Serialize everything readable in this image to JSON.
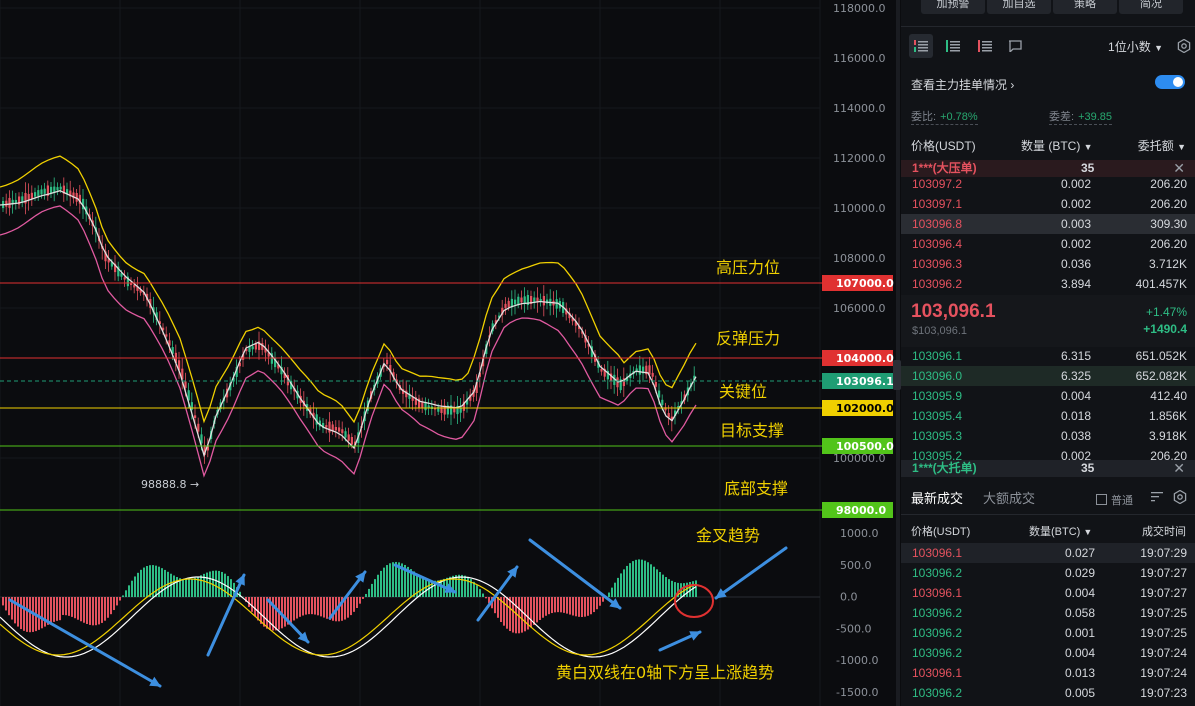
{
  "chart": {
    "y_axis_labels": [
      "118000.0",
      "116000.0",
      "114000.0",
      "112000.0",
      "110000.0",
      "108000.0",
      "106000.0",
      "104000.0",
      "102000.0",
      "100000.0"
    ],
    "macd_axis_labels": [
      "1000.0",
      "500.0",
      "0.0",
      "-500.0",
      "-1000.0",
      "-1500.0"
    ],
    "price_tags": [
      {
        "label": "107000.0",
        "bg": "#e03131",
        "fg": "#ffffff"
      },
      {
        "label": "104000.0",
        "bg": "#e03131",
        "fg": "#ffffff"
      },
      {
        "label": "103096.1",
        "bg": "#1f9d74",
        "fg": "#ffffff"
      },
      {
        "label": "102000.0",
        "bg": "#f0d000",
        "fg": "#000000"
      },
      {
        "label": "100500.0",
        "bg": "#52c41a",
        "fg": "#ffffff"
      },
      {
        "label": "98000.0",
        "bg": "#52c41a",
        "fg": "#ffffff"
      }
    ],
    "annotations": {
      "high_pressure": "高压力位",
      "rebound_pressure": "反弹压力",
      "key_level": "关键位",
      "target_support": "目标支撑",
      "bottom_support": "底部支撑",
      "golden_cross": "金叉趋势",
      "macd_note": "黄白双线在0轴下方呈上涨趋势",
      "low_marker": "98888.8 →"
    },
    "colors": {
      "up": "#2ebd85",
      "down": "#e5525f",
      "yellow": "#f0d000",
      "green_line": "#52c41a",
      "red_line": "#e03131"
    }
  },
  "panel": {
    "top_buttons": [
      "加预警",
      "加自选",
      "策略",
      "简况"
    ],
    "decimal_selector": "1位小数",
    "main_orders_label": "查看主力挂单情况",
    "ratio": {
      "label": "委比:",
      "value": "+0.78%"
    },
    "diff": {
      "label": "委差:",
      "value": "+39.85"
    },
    "book_headers": {
      "price": "价格(USDT)",
      "qty": "数量 (BTC)",
      "total": "委托额"
    },
    "ask_big": {
      "label": "1***(大压单)",
      "count": "35"
    },
    "asks": [
      {
        "price": "103097.2",
        "qty": "0.002",
        "total": "206.20"
      },
      {
        "price": "103097.1",
        "qty": "0.002",
        "total": "206.20"
      },
      {
        "price": "103096.8",
        "qty": "0.003",
        "total": "309.30"
      },
      {
        "price": "103096.4",
        "qty": "0.002",
        "total": "206.20"
      },
      {
        "price": "103096.3",
        "qty": "0.036",
        "total": "3.712K"
      },
      {
        "price": "103096.2",
        "qty": "3.894",
        "total": "401.457K"
      }
    ],
    "last_price": "103,096.1",
    "last_price_usd": "$103,096.1",
    "change_pct": "+1.47%",
    "change_abs": "+1490.4",
    "bids": [
      {
        "price": "103096.1",
        "qty": "6.315",
        "total": "651.052K"
      },
      {
        "price": "103096.0",
        "qty": "6.325",
        "total": "652.082K"
      },
      {
        "price": "103095.9",
        "qty": "0.004",
        "total": "412.40"
      },
      {
        "price": "103095.4",
        "qty": "0.018",
        "total": "1.856K"
      },
      {
        "price": "103095.3",
        "qty": "0.038",
        "total": "3.918K"
      },
      {
        "price": "103095.2",
        "qty": "0.002",
        "total": "206.20"
      }
    ],
    "bid_big": {
      "label": "1***(大托单)",
      "count": "35"
    },
    "tabs": {
      "latest": "最新成交",
      "large": "大额成交"
    },
    "normal_label": "普通",
    "trade_headers": {
      "price": "价格(USDT)",
      "qty": "数量(BTC)",
      "time": "成交时间"
    },
    "trades": [
      {
        "price": "103096.1",
        "qty": "0.027",
        "time": "19:07:29",
        "side": "sell"
      },
      {
        "price": "103096.2",
        "qty": "0.029",
        "time": "19:07:27",
        "side": "buy"
      },
      {
        "price": "103096.1",
        "qty": "0.004",
        "time": "19:07:27",
        "side": "sell"
      },
      {
        "price": "103096.2",
        "qty": "0.058",
        "time": "19:07:25",
        "side": "buy"
      },
      {
        "price": "103096.2",
        "qty": "0.001",
        "time": "19:07:25",
        "side": "buy"
      },
      {
        "price": "103096.2",
        "qty": "0.004",
        "time": "19:07:24",
        "side": "buy"
      },
      {
        "price": "103096.1",
        "qty": "0.013",
        "time": "19:07:24",
        "side": "sell"
      },
      {
        "price": "103096.2",
        "qty": "0.005",
        "time": "19:07:23",
        "side": "buy"
      }
    ]
  }
}
